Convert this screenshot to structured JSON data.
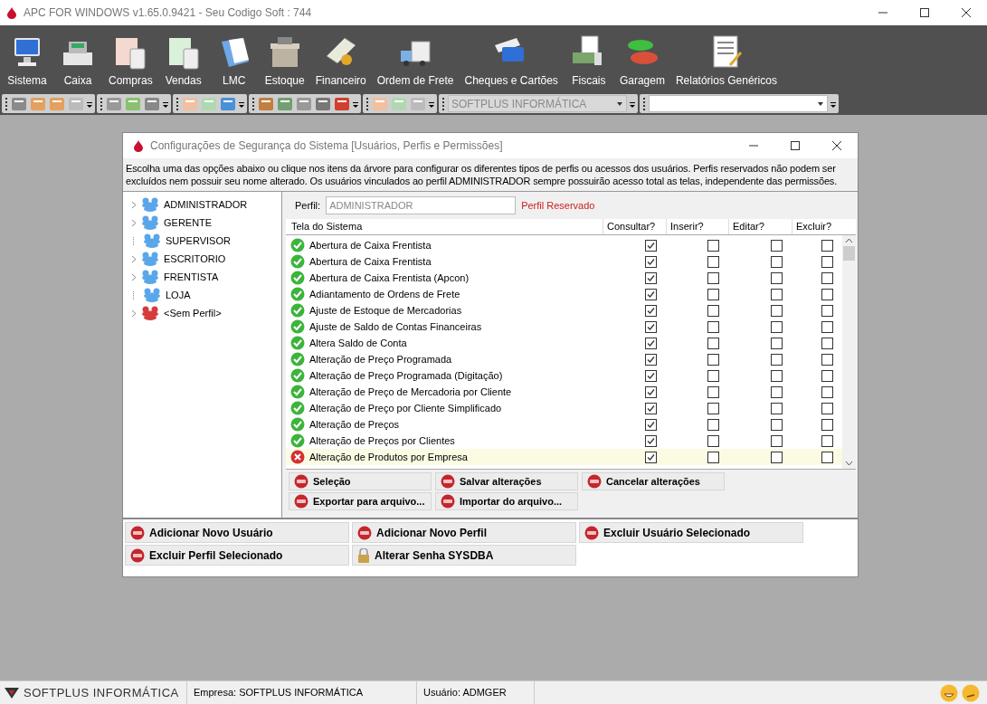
{
  "window": {
    "title": "APC FOR WINDOWS v1.65.0.9421 - Seu Codigo Soft : 744"
  },
  "menu": [
    {
      "label": "Sistema"
    },
    {
      "label": "Caixa"
    },
    {
      "label": "Compras"
    },
    {
      "label": "Vendas"
    },
    {
      "label": "LMC"
    },
    {
      "label": "Estoque"
    },
    {
      "label": "Financeiro"
    },
    {
      "label": "Ordem de Frete"
    },
    {
      "label": "Cheques e Cartões"
    },
    {
      "label": "Fiscais"
    },
    {
      "label": "Garagem"
    },
    {
      "label": "Relatórios Genéricos"
    }
  ],
  "toolbar": {
    "company_combo": {
      "value": "SOFTPLUS INFORMÁTICA",
      "disabled": true
    }
  },
  "dialog": {
    "title": "Configurações de Segurança do Sistema [Usuários, Perfis e Permissões]",
    "description": "Escolha uma das opções abaixo ou clique nos itens da árvore para configurar os diferentes tipos de perfis ou acessos dos usuários. Perfis reservados não podem ser excluídos nem possuir seu nome alterado. Os usuários vinculados ao perfil ADMINISTRADOR sempre possuirão acesso total as telas, independente das permissões.",
    "tree": [
      {
        "label": "ADMINISTRADOR",
        "kind": "profile",
        "expandable": true
      },
      {
        "label": "GERENTE",
        "kind": "profile",
        "expandable": true
      },
      {
        "label": "SUPERVISOR",
        "kind": "profile",
        "expandable": false
      },
      {
        "label": "ESCRITORIO",
        "kind": "profile",
        "expandable": true
      },
      {
        "label": "FRENTISTA",
        "kind": "profile",
        "expandable": true
      },
      {
        "label": "LOJA",
        "kind": "profile",
        "expandable": false
      },
      {
        "label": "<Sem Perfil>",
        "kind": "no_profile",
        "expandable": true
      }
    ],
    "profile": {
      "label": "Perfil:",
      "value": "ADMINISTRADOR",
      "note": "Perfil Reservado"
    },
    "table": {
      "columns": [
        "Tela do Sistema",
        "Consultar?",
        "Inserir?",
        "Editar?",
        "Excluir?"
      ],
      "rows": [
        {
          "name": "Abertura de Caixa Frentista",
          "kind": "ok",
          "selected": false,
          "consultar": true,
          "inserir": false,
          "editar": false,
          "excluir": false
        },
        {
          "name": "Abertura de Caixa Frentista",
          "kind": "ok",
          "selected": false,
          "consultar": true,
          "inserir": false,
          "editar": false,
          "excluir": false
        },
        {
          "name": "Abertura de Caixa Frentista (Apcon)",
          "kind": "ok",
          "selected": false,
          "consultar": true,
          "inserir": false,
          "editar": false,
          "excluir": false
        },
        {
          "name": "Adiantamento de Ordens de Frete",
          "kind": "ok",
          "selected": false,
          "consultar": true,
          "inserir": false,
          "editar": false,
          "excluir": false
        },
        {
          "name": "Ajuste de Estoque de Mercadorias",
          "kind": "ok",
          "selected": false,
          "consultar": true,
          "inserir": false,
          "editar": false,
          "excluir": false
        },
        {
          "name": "Ajuste de Saldo de Contas Financeiras",
          "kind": "ok",
          "selected": false,
          "consultar": true,
          "inserir": false,
          "editar": false,
          "excluir": false
        },
        {
          "name": "Altera Saldo de Conta",
          "kind": "ok",
          "selected": false,
          "consultar": true,
          "inserir": false,
          "editar": false,
          "excluir": false
        },
        {
          "name": "Alteração de Preço Programada",
          "kind": "ok",
          "selected": false,
          "consultar": true,
          "inserir": false,
          "editar": false,
          "excluir": false
        },
        {
          "name": "Alteração de Preço Programada (Digitação)",
          "kind": "ok",
          "selected": false,
          "consultar": true,
          "inserir": false,
          "editar": false,
          "excluir": false
        },
        {
          "name": "Alteração de Preço de Mercadoria por Cliente",
          "kind": "ok",
          "selected": false,
          "consultar": true,
          "inserir": false,
          "editar": false,
          "excluir": false
        },
        {
          "name": "Alteração de Preço por Cliente Simplificado",
          "kind": "ok",
          "selected": false,
          "consultar": true,
          "inserir": false,
          "editar": false,
          "excluir": false
        },
        {
          "name": "Alteração de Preços",
          "kind": "ok",
          "selected": false,
          "consultar": true,
          "inserir": false,
          "editar": false,
          "excluir": false
        },
        {
          "name": "Alteração de Preços por Clientes",
          "kind": "ok",
          "selected": false,
          "consultar": true,
          "inserir": false,
          "editar": false,
          "excluir": false
        },
        {
          "name": "Alteração de Produtos por Empresa",
          "kind": "error",
          "selected": true,
          "consultar": true,
          "inserir": false,
          "editar": false,
          "excluir": false
        }
      ]
    },
    "grid_buttons": [
      {
        "label": "Seleção"
      },
      {
        "label": "Salvar alterações"
      },
      {
        "label": "Cancelar alterações"
      },
      {
        "label": "Exportar para arquivo..."
      },
      {
        "label": "Importar do arquivo..."
      }
    ],
    "bottom_buttons": [
      {
        "label": "Adicionar Novo Usuário",
        "kind": "action"
      },
      {
        "label": "Adicionar Novo Perfil",
        "kind": "action"
      },
      {
        "label": "Excluir Usuário Selecionado",
        "kind": "action"
      },
      {
        "label": "Excluir Perfil Selecionado",
        "kind": "action"
      },
      {
        "label": "Alterar Senha SYSDBA",
        "kind": "lock"
      }
    ]
  },
  "status_bar": {
    "brand": "SOFTPLUS INFORMÁTICA",
    "company": "Empresa: SOFTPLUS INFORMÁTICA",
    "user": "Usuário: ADMGER"
  }
}
